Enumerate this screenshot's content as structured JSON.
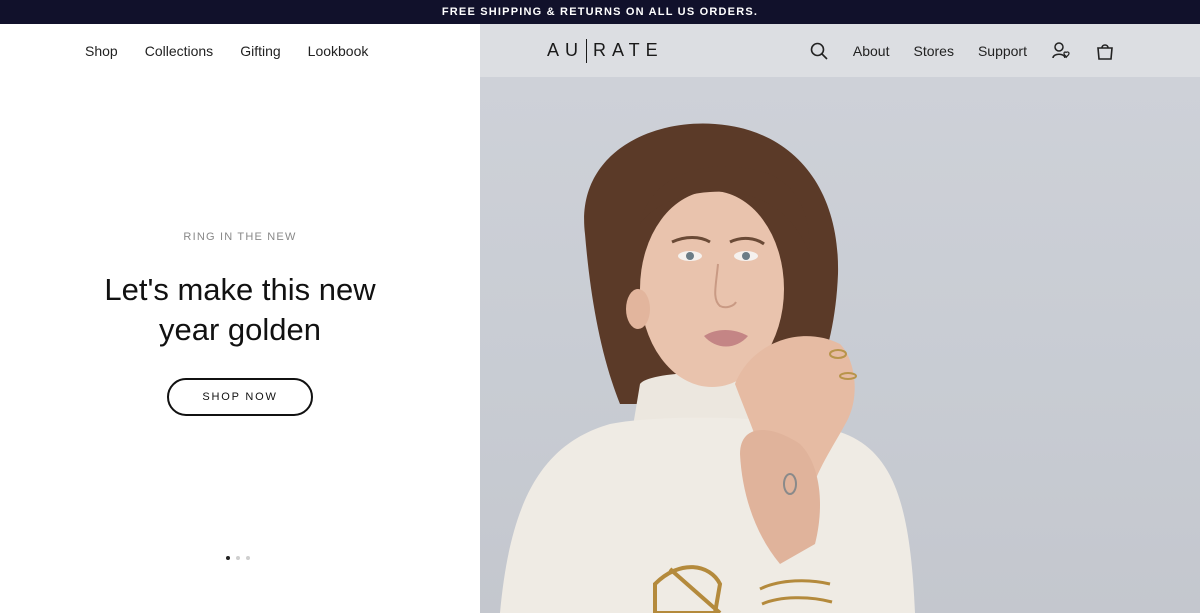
{
  "announcement": "FREE SHIPPING & RETURNS ON ALL US ORDERS.",
  "nav": {
    "left": [
      "Shop",
      "Collections",
      "Gifting",
      "Lookbook"
    ],
    "logo": {
      "left": "AU",
      "right": "RATE"
    },
    "right": [
      "About",
      "Stores",
      "Support"
    ],
    "icons": [
      "search-icon",
      "account-heart-icon",
      "shopping-bag-icon"
    ]
  },
  "hero": {
    "eyebrow": "RING IN THE NEW",
    "headline_line1": "Let's make this new",
    "headline_line2": "year golden",
    "cta": "SHOP NOW",
    "slides": {
      "count": 3,
      "active": 1
    }
  },
  "colors": {
    "topbar": "#11112b",
    "hero_bg": "#c8ccd3",
    "text": "#111111",
    "eyebrow": "#888888"
  }
}
